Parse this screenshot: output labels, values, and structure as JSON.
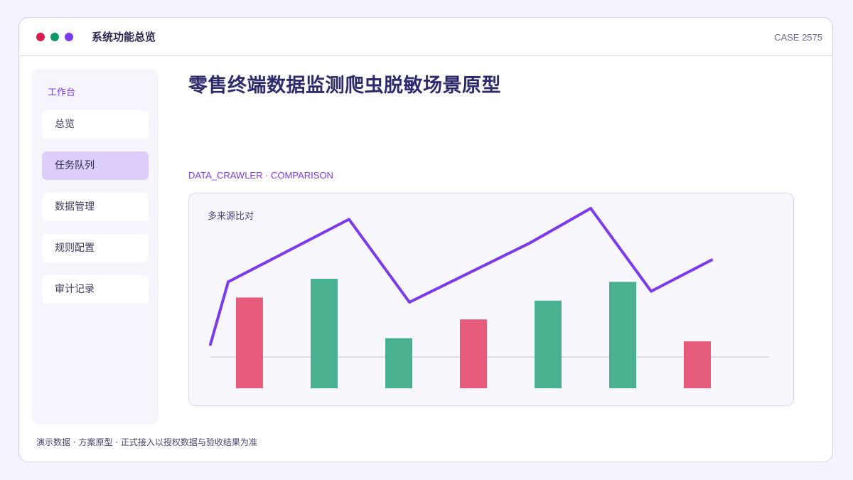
{
  "window": {
    "title": "系统功能总览",
    "case_id": "CASE 2575",
    "traffic_lights": [
      "#d91e4b",
      "#0d9668",
      "#7c3aed"
    ]
  },
  "sidebar": {
    "heading": "工作台",
    "items": [
      {
        "label": "总览",
        "active": false
      },
      {
        "label": "任务队列",
        "active": true
      },
      {
        "label": "数据管理",
        "active": false
      },
      {
        "label": "规则配置",
        "active": false
      },
      {
        "label": "审计记录",
        "active": false
      }
    ]
  },
  "main": {
    "title": "零售终端数据监测爬虫脱敏场景原型",
    "section_label": "DATA_CRAWLER · COMPARISON",
    "card_title": "多来源比对"
  },
  "footer": {
    "note": "演示数据 · 方案原型 · 正式接入以授权数据与验收结果为准"
  },
  "colors": {
    "accent": "#7c3aed",
    "bar_red": "#e65a7b",
    "bar_green": "#4ab190",
    "baseline": "#d6d2e8"
  },
  "chart_data": {
    "type": "bar",
    "title": "",
    "xlabel": "",
    "ylabel": "",
    "ylim": [
      0,
      100
    ],
    "baseline": 20,
    "bars": [
      {
        "value": 58,
        "color": "red"
      },
      {
        "value": 70,
        "color": "green"
      },
      {
        "value": 32,
        "color": "green"
      },
      {
        "value": 44,
        "color": "red"
      },
      {
        "value": 56,
        "color": "green"
      },
      {
        "value": 68,
        "color": "green"
      },
      {
        "value": 30,
        "color": "red"
      }
    ],
    "line": [
      28,
      68,
      108,
      55,
      93,
      115,
      62,
      82
    ],
    "grid": false,
    "legend": "none"
  }
}
